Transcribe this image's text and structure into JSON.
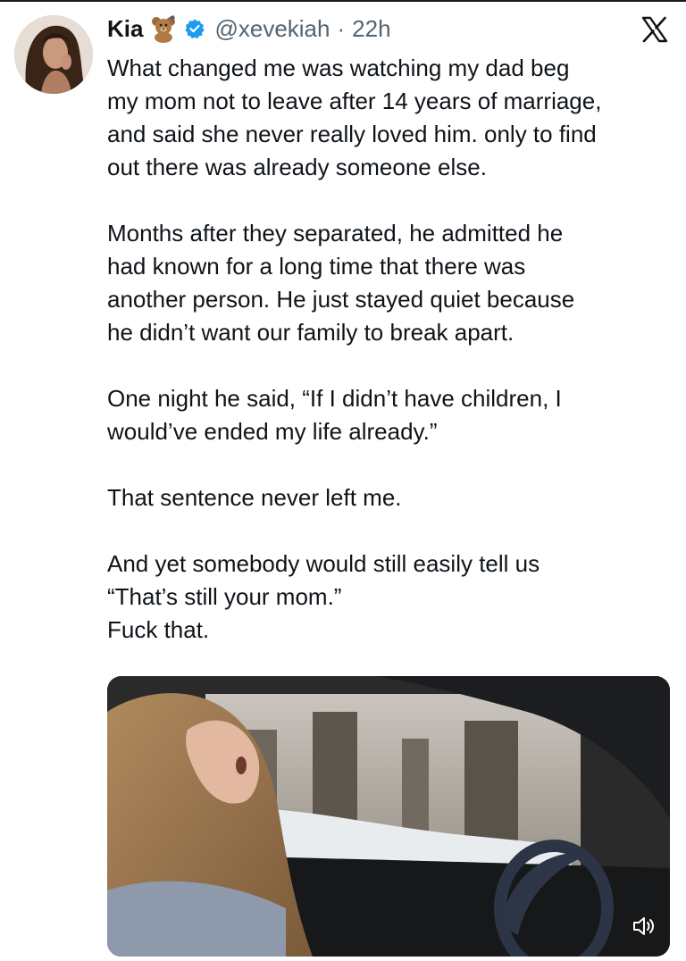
{
  "author": {
    "name": "Kia",
    "handle": "@xevekiah",
    "separator": "·",
    "time": "22h",
    "badge_emoji": "teddy-bear-emoji",
    "verified_icon": "verified-badge-icon"
  },
  "platform_icon": "x-logo-icon",
  "tweet": {
    "paragraphs": [
      "What changed me was watching my dad beg\nmy mom not to leave after 14 years of marriage,\nand said she never really loved him. only to find\nout there was already someone else.",
      "Months after they separated, he admitted he\nhad known for a long time that there was\nanother person. He just stayed quiet because\nhe didn’t want our family to break apart.",
      "One night he said, “If I didn’t have children, I\nwould’ve ended my life already.”",
      "That sentence never left me.",
      "And yet somebody would still easily tell us\n“That’s still your mom.”\nFuck that."
    ]
  },
  "media": {
    "type": "video",
    "control_icon": "volume-icon"
  },
  "colors": {
    "text": "#0f1419",
    "secondary": "#536471",
    "verified": "#1d9bf0"
  }
}
